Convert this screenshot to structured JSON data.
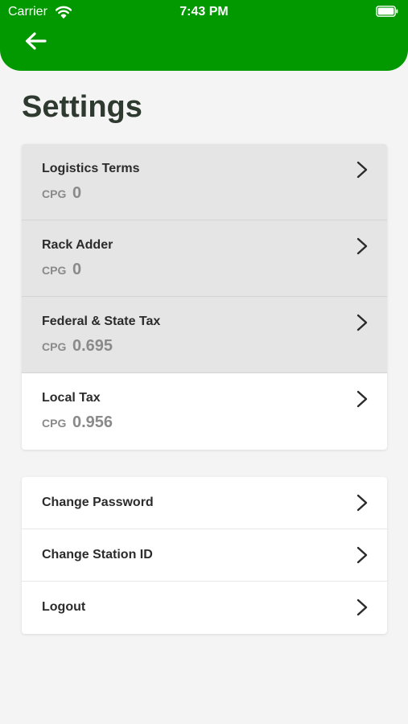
{
  "status_bar": {
    "carrier": "Carrier",
    "time": "7:43 PM"
  },
  "header": {
    "back_icon": "arrow-left-icon",
    "color": "#029900"
  },
  "page": {
    "title": "Settings"
  },
  "fees": [
    {
      "label": "Logistics Terms",
      "unit": "CPG",
      "value": "0",
      "shaded": true
    },
    {
      "label": "Rack Adder",
      "unit": "CPG",
      "value": "0",
      "shaded": true
    },
    {
      "label": "Federal & State Tax",
      "unit": "CPG",
      "value": "0.695",
      "shaded": true
    },
    {
      "label": "Local Tax",
      "unit": "CPG",
      "value": "0.956",
      "shaded": false
    }
  ],
  "account": [
    {
      "label": "Change Password"
    },
    {
      "label": "Change Station ID"
    },
    {
      "label": "Logout"
    }
  ],
  "icons": {
    "row_action": "chevron-right-icon"
  }
}
